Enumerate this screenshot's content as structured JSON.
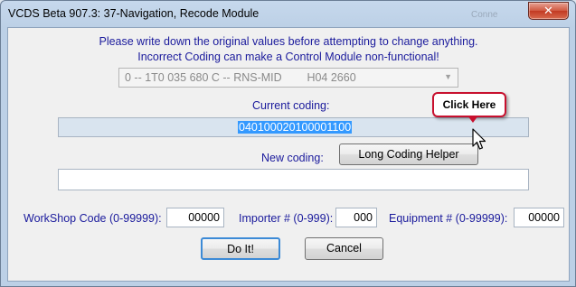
{
  "window": {
    "title": "VCDS Beta 907.3: 37-Navigation,  Recode Module",
    "background_ghost_text": "Conne",
    "close_glyph": "✕"
  },
  "warning": {
    "line1": "Please write down the original values before attempting to change anything.",
    "line2": "Incorrect Coding can make a Control Module non-functional!"
  },
  "module_select": {
    "value": "0 -- 1T0 035 680 C -- RNS-MID        H04 2660"
  },
  "current_coding": {
    "label": "Current coding:",
    "value": "040100020100001100"
  },
  "new_coding": {
    "label": "New coding:",
    "helper_button": "Long Coding Helper",
    "value": ""
  },
  "callout": {
    "text": "Click Here"
  },
  "fields": {
    "workshop_label": "WorkShop Code (0-99999):",
    "workshop_value": "00000",
    "importer_label": "Importer # (0-999):",
    "importer_value": "000",
    "equipment_label": "Equipment # (0-99999):",
    "equipment_value": "00000"
  },
  "buttons": {
    "do_it": "Do It!",
    "cancel": "Cancel"
  },
  "colors": {
    "label_blue": "#1a1a9c",
    "selection": "#3399ff",
    "callout_border": "#c8102e",
    "close_red": "#c23a22"
  }
}
